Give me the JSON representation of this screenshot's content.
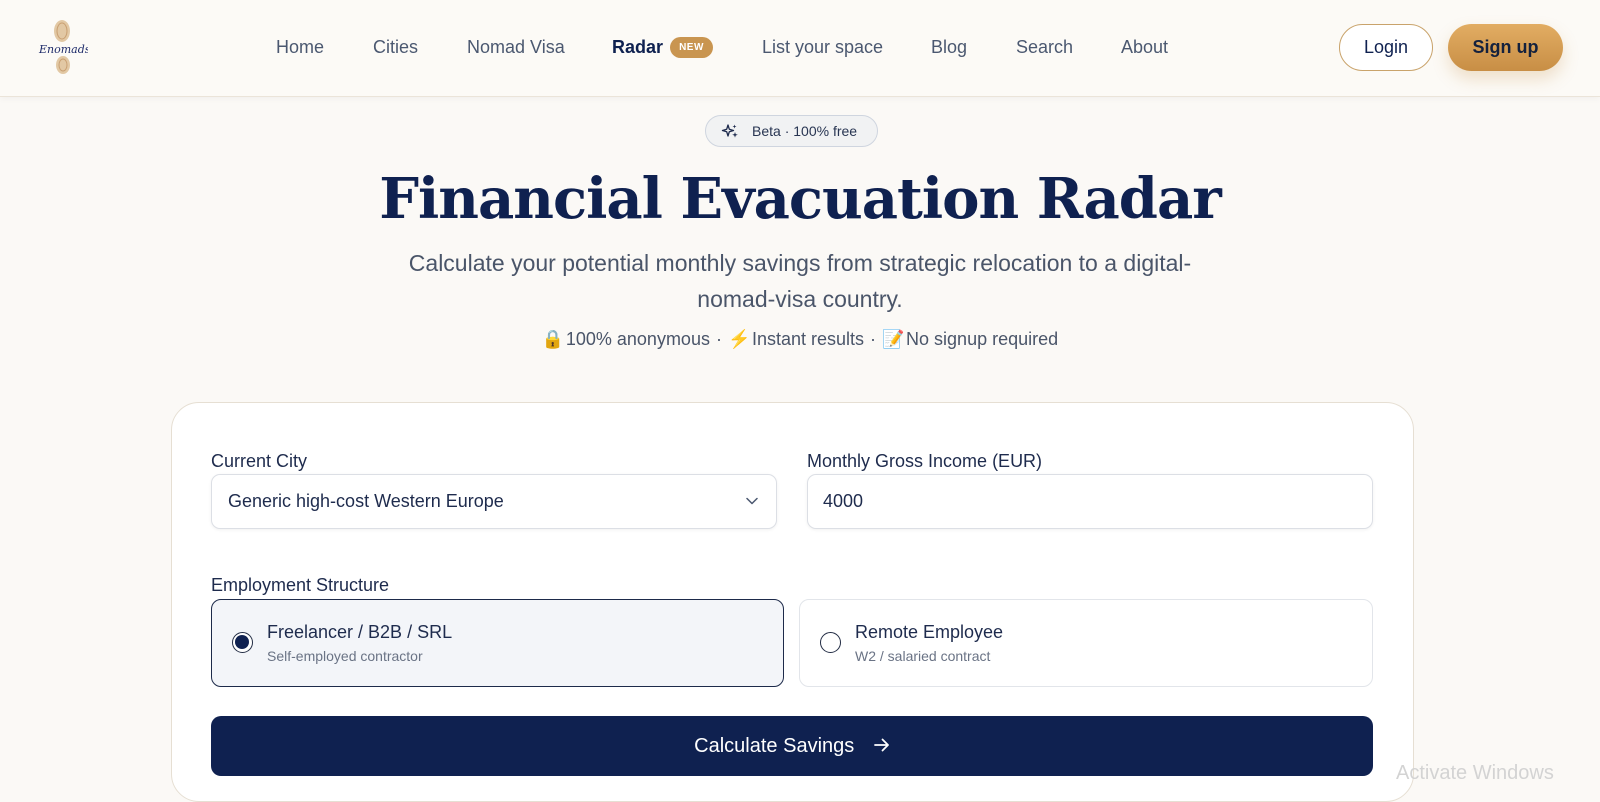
{
  "nav": {
    "items": [
      "Home",
      "Cities",
      "Nomad Visa",
      "Radar",
      "List your space",
      "Blog",
      "Search",
      "About"
    ],
    "active": "Radar",
    "new_badge": "NEW",
    "login_label": "Login",
    "signup_label": "Sign up"
  },
  "logo": {
    "text": "Enomads"
  },
  "hero": {
    "beta_pill": "Beta · 100% free",
    "title": "Financial Evacuation Radar",
    "subtitle": "Calculate your potential monthly savings from strategic relocation to a digital-nomad-visa country.",
    "trust": [
      {
        "emoji": "🔒",
        "text": "100% anonymous"
      },
      {
        "emoji": "⚡",
        "text": "Instant results"
      },
      {
        "emoji": "📝",
        "text": "No signup required"
      }
    ],
    "trust_separator": "·"
  },
  "form": {
    "city_label": "Current City",
    "city_value": "Generic high-cost Western Europe",
    "income_label": "Monthly Gross Income (EUR)",
    "income_value": "4000",
    "employment_label": "Employment Structure",
    "options": [
      {
        "title": "Freelancer / B2B / SRL",
        "desc": "Self-employed contractor",
        "selected": true
      },
      {
        "title": "Remote Employee",
        "desc": "W2 / salaried contract",
        "selected": false
      }
    ],
    "submit_label": "Calculate Savings"
  },
  "watermark": "Activate Windows",
  "colors": {
    "navy": "#0f2150",
    "gold": "#c99550",
    "background": "#fbf9f6"
  }
}
